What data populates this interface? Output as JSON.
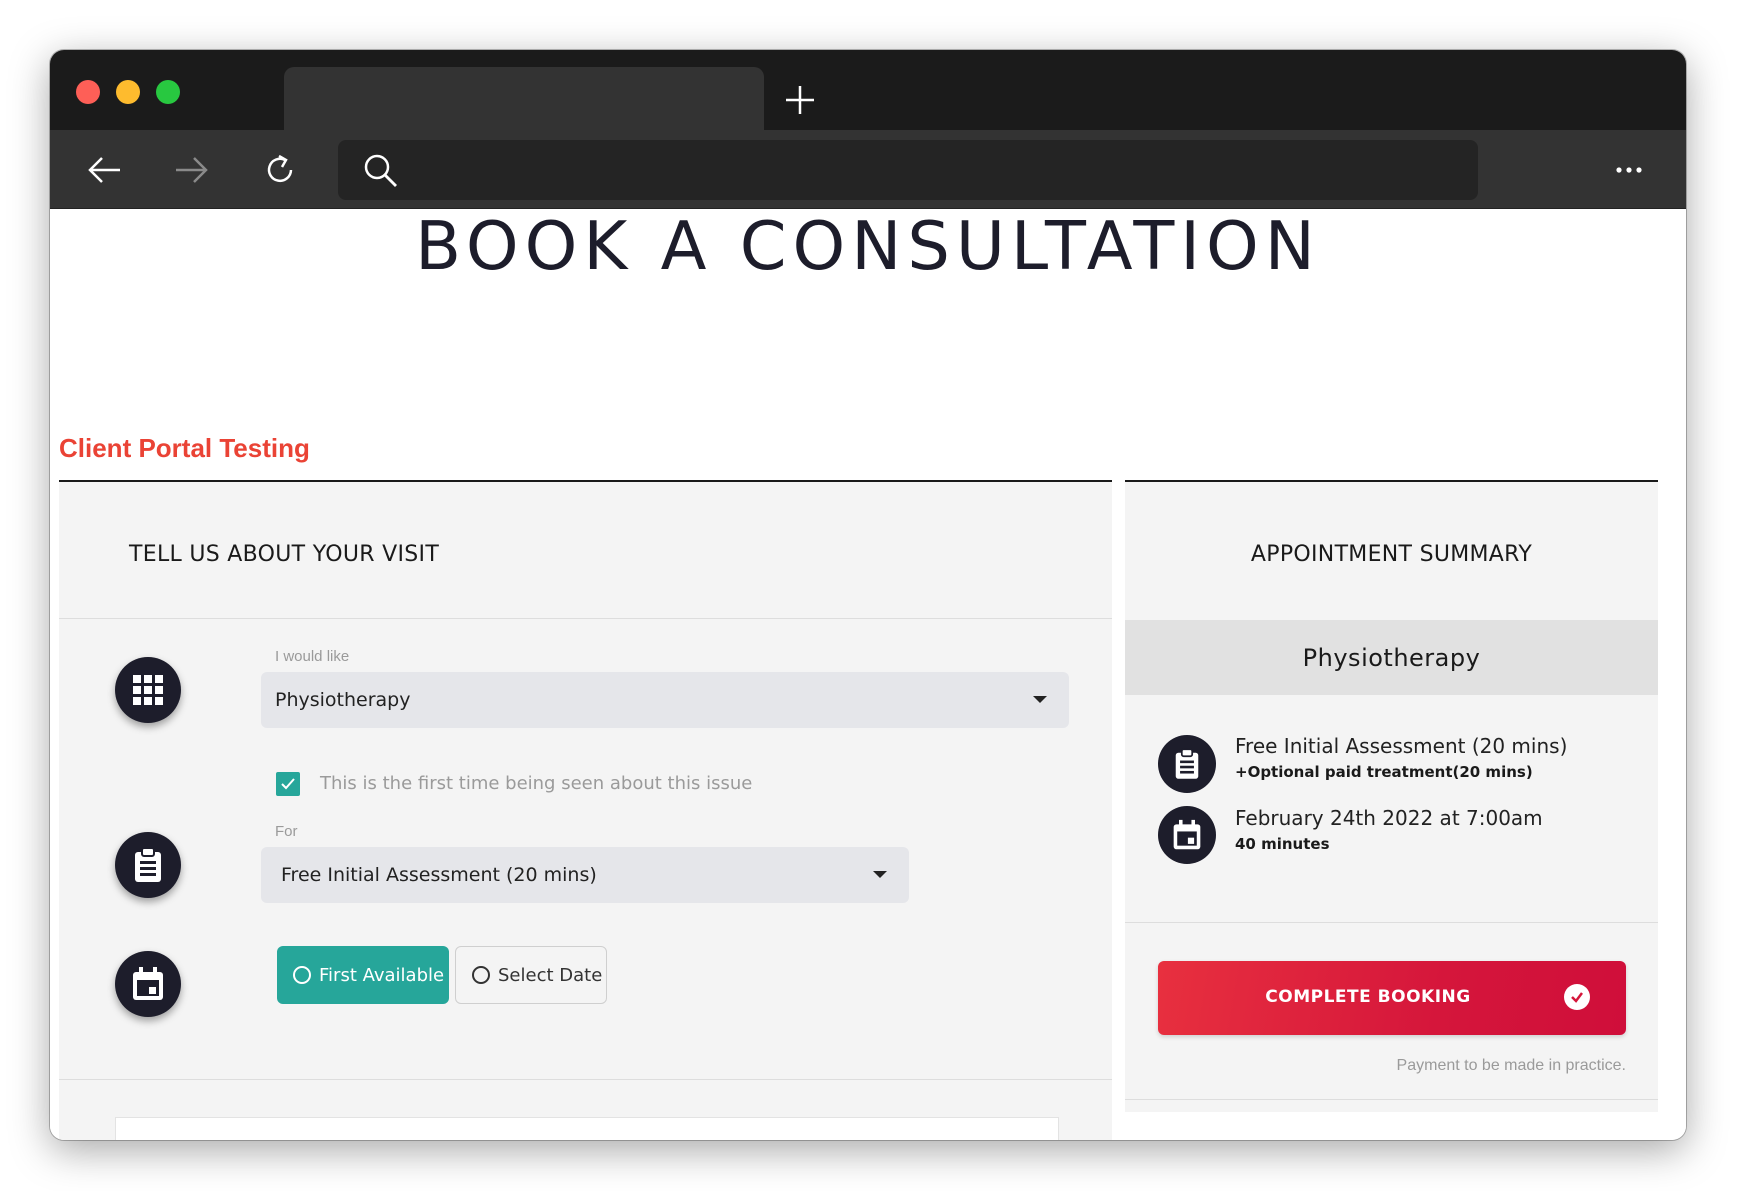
{
  "browser": {
    "new_tab_symbol": "+",
    "more_symbol": "⋯"
  },
  "page": {
    "title": "BOOK A CONSULTATION",
    "portal_title": "Client Portal Testing"
  },
  "visit": {
    "heading": "TELL US ABOUT YOUR VISIT",
    "service_label": "I would like",
    "service_value": "Physiotherapy",
    "first_time_checked": true,
    "first_time_label": "This is the first time being seen about this issue",
    "for_label": "For",
    "for_value": "Free Initial Assessment (20 mins)",
    "date_options": [
      {
        "label": "First Available",
        "selected": true
      },
      {
        "label": "Select Date",
        "selected": false
      }
    ]
  },
  "summary": {
    "heading": "APPOINTMENT SUMMARY",
    "service": "Physiotherapy",
    "appointment_type": "Free Initial Assessment (20 mins)",
    "appointment_extra": "+Optional paid treatment(20 mins)",
    "datetime": "February 24th 2022 at 7:00am",
    "duration": "40 minutes",
    "complete_label": "COMPLETE BOOKING",
    "payment_note": "Payment to be made in practice."
  },
  "colors": {
    "accent_teal": "#26a69a",
    "booking_red": "#d5163b",
    "portal_red": "#ea4335",
    "icon_dark": "#1d1d2b"
  },
  "icons": [
    "back-arrow-icon",
    "forward-arrow-icon",
    "reload-icon",
    "search-icon",
    "more-icon",
    "grid-icon",
    "clipboard-icon",
    "calendar-icon",
    "check-circle-icon"
  ]
}
